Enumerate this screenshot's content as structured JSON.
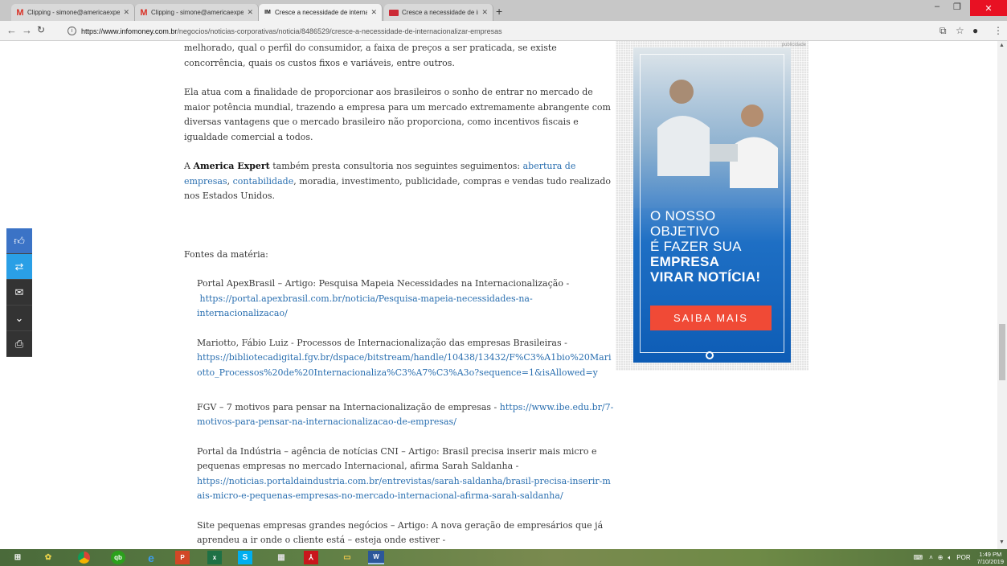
{
  "browser": {
    "tabs": [
      {
        "title": "Clipping - simone@americaexpe",
        "favicon": "gmail-icon",
        "active": false
      },
      {
        "title": "Clipping - simone@americaexpe",
        "favicon": "gmail-icon",
        "active": false
      },
      {
        "title": "Cresce a necessidade de internac",
        "favicon": "infomoney-icon",
        "active": true
      },
      {
        "title": "Cresce a necessidade de internac",
        "favicon": "red-square-icon",
        "active": false
      }
    ],
    "url_host": "https://www.infomoney.com.br",
    "url_path": "/negocios/noticias-corporativas/noticia/8486529/cresce-a-necessidade-de-internacionalizar-empresas"
  },
  "article": {
    "p1": "melhorado, qual o perfil do consumidor, a faixa de preços a ser praticada, se existe concorrência, quais os custos fixos e variáveis, entre outros.",
    "p2": "Ela atua com a finalidade de proporcionar aos brasileiros o sonho de entrar no mercado de maior potência mundial, trazendo a empresa para um mercado extremamente abrangente com diversas vantagens que o mercado brasileiro não proporciona, como incentivos fiscais e igualdade comercial a todos.",
    "p3_a": "A ",
    "p3_brand": "America Expert",
    "p3_b": " também presta consultoria nos seguintes seguimentos: ",
    "p3_link1": "abertura de empresas",
    "p3_c": ", ",
    "p3_link2": "contabilidade",
    "p3_d": ", moradia, investimento, publicidade, compras e vendas tudo realizado nos Estados Unidos.",
    "sources_heading": "Fontes da matéria:",
    "s1_text": "Portal ApexBrasil – Artigo: Pesquisa Mapeia Necessidades na Internacionalização -",
    "s1_link": "https://portal.apexbrasil.com.br/noticia/Pesquisa-mapeia-necessidades-na-internacionalizacao/",
    "s2_text": "Mariotto, Fábio Luiz  - Processos de Internacionalização das empresas Brasileiras -",
    "s2_link": "https://bibliotecadigital.fgv.br/dspace/bitstream/handle/10438/13432/F%C3%A1bio%20Mariotto_Processos%20de%20Internacionaliza%C3%A7%C3%A3o?sequence=1&isAllowed=y",
    "s3_text": "FGV – 7 motivos para pensar na Internacionalização de empresas - ",
    "s3_link": "https://www.ibe.edu.br/7-motivos-para-pensar-na-internacionalizacao-de-empresas/",
    "s4_text": "Portal da Indústria – agência de notícias CNI – Artigo: Brasil precisa inserir mais micro e pequenas empresas no mercado Internacional, afirma Sarah Saldanha -",
    "s4_link": "https://noticias.portaldaindustria.com.br/entrevistas/sarah-saldanha/brasil-precisa-inserir-mais-micro-e-pequenas-empresas-no-mercado-internacional-afirma-sarah-saldanha/",
    "s5_text": "Site pequenas empresas grandes negócios – Artigo: A nova geração de empresários que já aprendeu a ir onde o cliente está – esteja onde estiver -"
  },
  "ad": {
    "label": "publicidade",
    "line1": "O NOSSO",
    "line2": "OBJETIVO",
    "line3": "É FAZER SUA",
    "line4": "EMPRESA",
    "line5": "VIRAR NOTÍCIA!",
    "button": "SAIBA MAIS"
  },
  "taskbar": {
    "language": "POR",
    "time": "1:49 PM",
    "date": "7/10/2019"
  },
  "colors": {
    "link": "#2a6fb0",
    "ad_button": "#f04a36",
    "share_like": "#3b73c6",
    "share_retweet": "#2a9fe6"
  }
}
